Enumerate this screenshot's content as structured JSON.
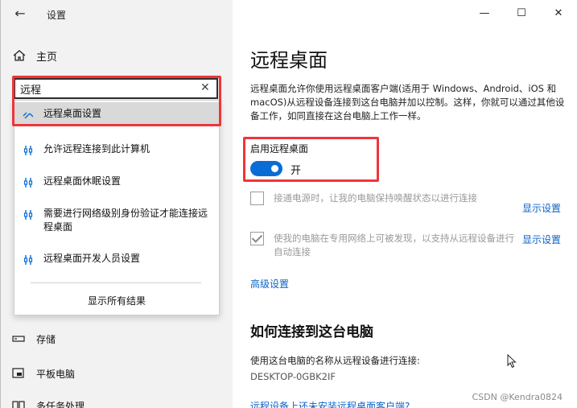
{
  "window": {
    "back_label": "←",
    "title": "设置",
    "minimize": "—",
    "maximize": "☐",
    "close": "✕"
  },
  "sidebar": {
    "home_label": "主页",
    "items_below": [
      {
        "label": "存储",
        "icon": "storage-icon"
      },
      {
        "label": "平板电脑",
        "icon": "tablet-icon"
      },
      {
        "label": "多任务处理",
        "icon": "multitask-icon"
      }
    ]
  },
  "search": {
    "value": "远程",
    "placeholder": "",
    "clear_icon": "✕",
    "results": [
      {
        "label": "远程桌面设置",
        "icon": "remote-desktop-icon",
        "highlighted": true
      },
      {
        "label": "允许远程连接到此计算机",
        "icon": "settings-tool-icon"
      },
      {
        "label": "远程桌面休眠设置",
        "icon": "settings-tool-icon"
      },
      {
        "label": "需要进行网络级别身份验证才能连接远程桌面",
        "icon": "settings-tool-icon"
      },
      {
        "label": "远程桌面开发人员设置",
        "icon": "settings-tool-icon"
      }
    ],
    "show_all": "显示所有结果"
  },
  "main": {
    "title": "远程桌面",
    "description": "远程桌面允许你使用远程桌面客户端(适用于 Windows、Android、iOS 和 macOS)从远程设备连接到这台电脑并加以控制。这样，你就可以通过其他设备工作，如同直接在这台电脑上工作一样。",
    "enable_label": "启用远程桌面",
    "toggle_state": "开",
    "toggle_on": true,
    "options": [
      {
        "label": "接通电源时，让我的电脑保持唤醒状态以进行连接",
        "checked": false,
        "link": "显示设置"
      },
      {
        "label": "使我的电脑在专用网络上可被发现，以支持从远程设备进行自动连接",
        "checked": true,
        "link": "显示设置"
      }
    ],
    "advanced_link": "高级设置",
    "how_to_title": "如何连接到这台电脑",
    "connect_text": "使用这台电脑的名称从远程设备进行连接:",
    "pc_name": "DESKTOP-0GBK2IF",
    "client_link": "远程设备上还未安装远程桌面客户端?"
  },
  "watermark": "CSDN @Kendra0824",
  "colors": {
    "accent": "#0a6dd6",
    "highlight_box": "#f0353b",
    "link": "#0a63c9"
  }
}
